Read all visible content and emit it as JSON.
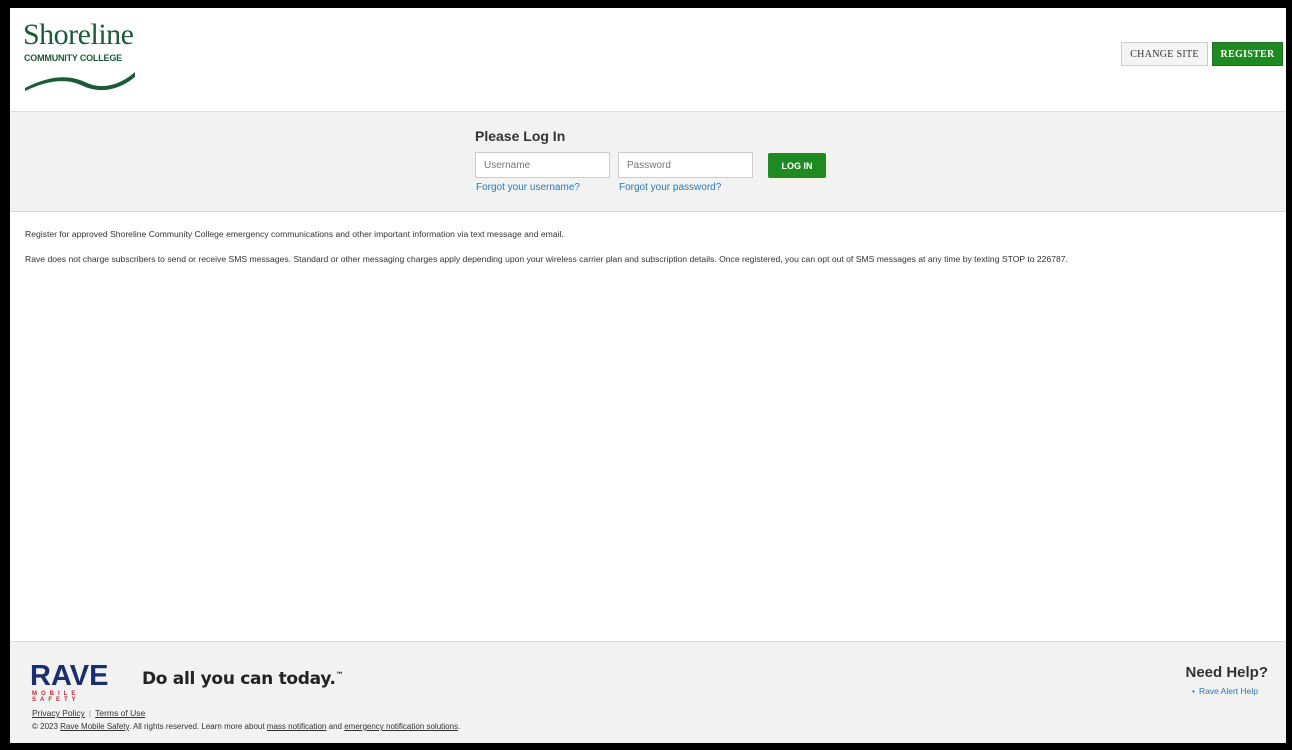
{
  "header": {
    "logo_name": "Shoreline",
    "logo_sub": "COMMUNITY COLLEGE",
    "change_site_label": "CHANGE SITE",
    "register_label": "REGISTER"
  },
  "login": {
    "title": "Please Log In",
    "username_placeholder": "Username",
    "password_placeholder": "Password",
    "login_label": "LOG IN",
    "forgot_username": "Forgot your username?",
    "forgot_password": "Forgot your password?"
  },
  "content": {
    "para1": "Register for approved Shoreline Community College emergency communications and other important information via text message and email.",
    "para2": "Rave does not charge subscribers to send or receive SMS messages. Standard or other messaging charges apply depending upon your wireless carrier plan and subscription details. Once registered, you can opt out of SMS messages at any time by texting STOP to 226787."
  },
  "footer": {
    "rave_word": "RAVE",
    "rave_sub": "MOBILE SAFETY",
    "tagline": "Do all you can today.",
    "tagline_mark": "™",
    "privacy_policy": "Privacy Policy",
    "terms_of_use": "Terms of Use",
    "copyright_prefix": "© 2023",
    "copyright_company": "Rave Mobile Safety",
    "copyright_middle": ". All rights reserved. Learn more about",
    "mass_notification": "mass notification",
    "and_text": "and",
    "emergency_notification": "emergency notification solutions",
    "copyright_end": ".",
    "need_help": "Need Help?",
    "help_link": "Rave Alert Help"
  },
  "colors": {
    "brand_green": "#1d5a3a",
    "button_green": "#1f8a22",
    "link_blue": "#2a7ab0",
    "rave_navy": "#1a2f6b"
  }
}
